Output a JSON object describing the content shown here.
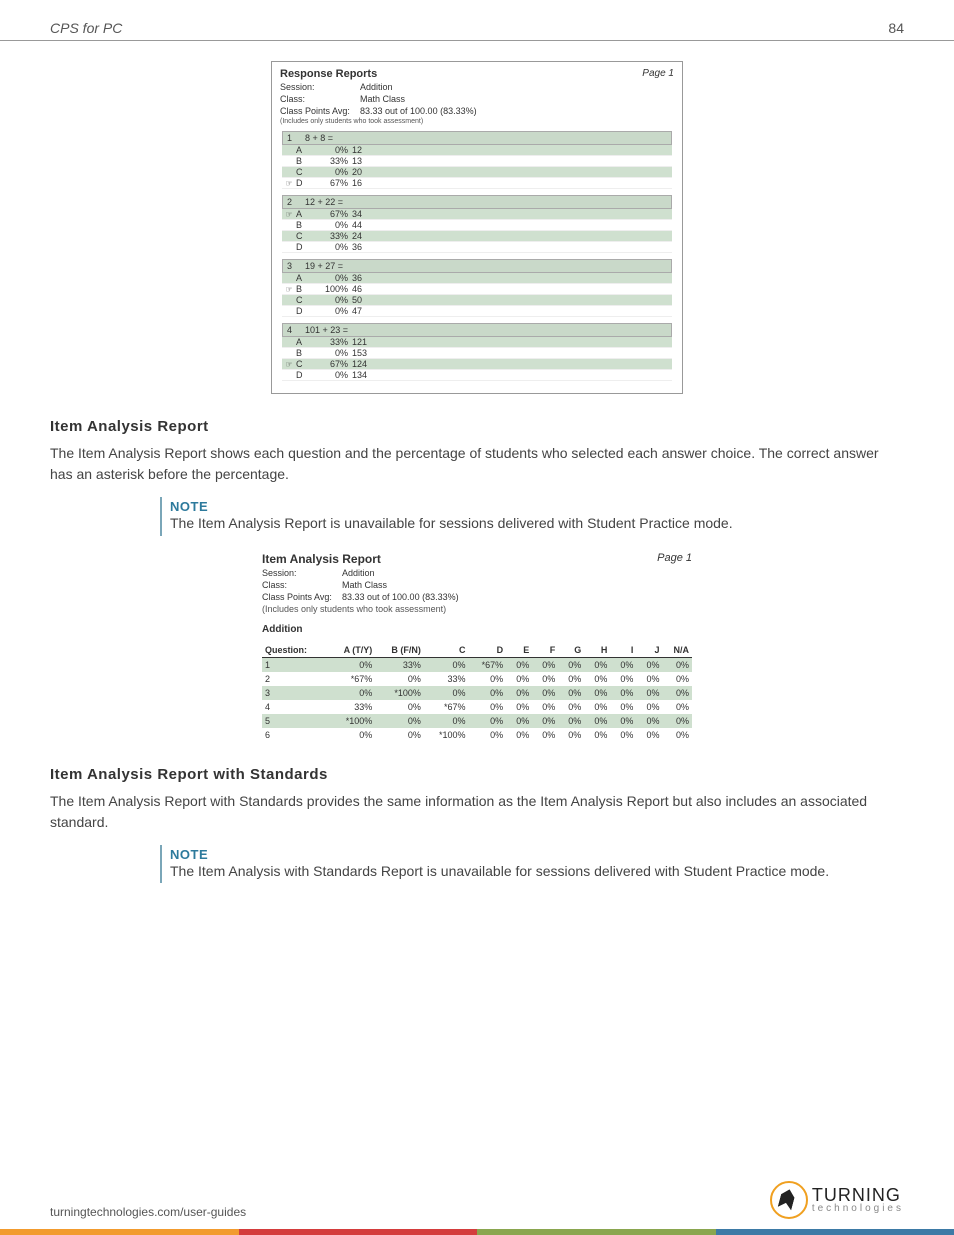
{
  "header": {
    "title": "CPS for PC",
    "pageNumber": "84"
  },
  "responseReport": {
    "title": "Response Reports",
    "pageLabel": "Page 1",
    "sessionLabel": "Session:",
    "sessionValue": "Addition",
    "classLabel": "Class:",
    "classValue": "Math Class",
    "avgLabel": "Class Points Avg:",
    "avgValue": "83.33 out of 100.00 (83.33%)",
    "note": "(Includes only students who took assessment)",
    "questions": [
      {
        "num": "1",
        "text": "8 + 8 =",
        "rows": [
          {
            "ptr": "",
            "let": "A",
            "pct": "0%",
            "val": "12",
            "shade": "green"
          },
          {
            "ptr": "",
            "let": "B",
            "pct": "33%",
            "val": "13",
            "shade": "white"
          },
          {
            "ptr": "",
            "let": "C",
            "pct": "0%",
            "val": "20",
            "shade": "green"
          },
          {
            "ptr": "☞",
            "let": "D",
            "pct": "67%",
            "val": "16",
            "shade": "white"
          }
        ]
      },
      {
        "num": "2",
        "text": "12 + 22 =",
        "rows": [
          {
            "ptr": "☞",
            "let": "A",
            "pct": "67%",
            "val": "34",
            "shade": "green"
          },
          {
            "ptr": "",
            "let": "B",
            "pct": "0%",
            "val": "44",
            "shade": "white"
          },
          {
            "ptr": "",
            "let": "C",
            "pct": "33%",
            "val": "24",
            "shade": "green"
          },
          {
            "ptr": "",
            "let": "D",
            "pct": "0%",
            "val": "36",
            "shade": "white"
          }
        ]
      },
      {
        "num": "3",
        "text": "19 + 27 =",
        "rows": [
          {
            "ptr": "",
            "let": "A",
            "pct": "0%",
            "val": "36",
            "shade": "green"
          },
          {
            "ptr": "☞",
            "let": "B",
            "pct": "100%",
            "val": "46",
            "shade": "white"
          },
          {
            "ptr": "",
            "let": "C",
            "pct": "0%",
            "val": "50",
            "shade": "green"
          },
          {
            "ptr": "",
            "let": "D",
            "pct": "0%",
            "val": "47",
            "shade": "white"
          }
        ]
      },
      {
        "num": "4",
        "text": "101 + 23 =",
        "rows": [
          {
            "ptr": "",
            "let": "A",
            "pct": "33%",
            "val": "121",
            "shade": "green"
          },
          {
            "ptr": "",
            "let": "B",
            "pct": "0%",
            "val": "153",
            "shade": "white"
          },
          {
            "ptr": "☞",
            "let": "C",
            "pct": "67%",
            "val": "124",
            "shade": "green"
          },
          {
            "ptr": "",
            "let": "D",
            "pct": "0%",
            "val": "134",
            "shade": "white"
          }
        ]
      }
    ]
  },
  "sections": {
    "ia": {
      "heading": "Item Analysis Report",
      "body": "The Item Analysis Report shows each question and the percentage of students who selected each answer choice. The correct answer has an asterisk before the percentage.",
      "noteHead": "NOTE",
      "noteBody": "The Item Analysis Report is unavailable for sessions delivered with Student Practice mode."
    },
    "ias": {
      "heading": "Item Analysis Report with Standards",
      "body": "The Item Analysis Report with Standards provides the same information as the Item Analysis Report but also includes an associated standard.",
      "noteHead": "NOTE",
      "noteBody": "The Item Analysis with Standards Report is unavailable for sessions delivered with Student Practice mode."
    }
  },
  "itemAnalysis": {
    "title": "Item Analysis Report",
    "pageLabel": "Page 1",
    "sessionLabel": "Session:",
    "sessionValue": "Addition",
    "classLabel": "Class:",
    "classValue": "Math Class",
    "avgLabel": "Class Points Avg:",
    "avgValue": "83.33 out of 100.00 (83.33%)",
    "note": "(Includes only students who took assessment)",
    "subtitle": "Addition",
    "headers": [
      "Question:",
      "A (T/Y)",
      "B (F/N)",
      "C",
      "D",
      "E",
      "F",
      "G",
      "H",
      "I",
      "J",
      "N/A"
    ],
    "rows": [
      {
        "shade": true,
        "cells": [
          "1",
          "0%",
          "33%",
          "0%",
          "*67%",
          "0%",
          "0%",
          "0%",
          "0%",
          "0%",
          "0%",
          "0%"
        ]
      },
      {
        "shade": false,
        "cells": [
          "2",
          "*67%",
          "0%",
          "33%",
          "0%",
          "0%",
          "0%",
          "0%",
          "0%",
          "0%",
          "0%",
          "0%"
        ]
      },
      {
        "shade": true,
        "cells": [
          "3",
          "0%",
          "*100%",
          "0%",
          "0%",
          "0%",
          "0%",
          "0%",
          "0%",
          "0%",
          "0%",
          "0%"
        ]
      },
      {
        "shade": false,
        "cells": [
          "4",
          "33%",
          "0%",
          "*67%",
          "0%",
          "0%",
          "0%",
          "0%",
          "0%",
          "0%",
          "0%",
          "0%"
        ]
      },
      {
        "shade": true,
        "cells": [
          "5",
          "*100%",
          "0%",
          "0%",
          "0%",
          "0%",
          "0%",
          "0%",
          "0%",
          "0%",
          "0%",
          "0%"
        ]
      },
      {
        "shade": false,
        "cells": [
          "6",
          "0%",
          "0%",
          "*100%",
          "0%",
          "0%",
          "0%",
          "0%",
          "0%",
          "0%",
          "0%",
          "0%"
        ]
      }
    ]
  },
  "footer": {
    "link": "turningtechnologies.com/user-guides",
    "logoTop": "TURNING",
    "logoBottom": "technologies"
  }
}
